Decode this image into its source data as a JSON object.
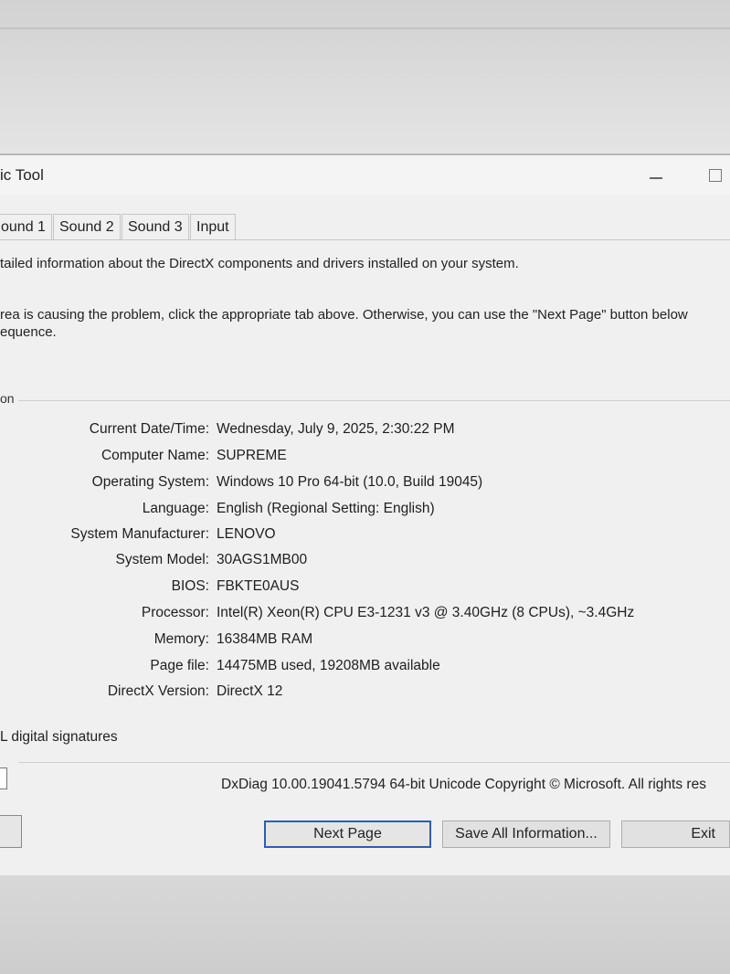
{
  "window": {
    "title": "ic Tool"
  },
  "tabs": [
    {
      "label": "ound 1"
    },
    {
      "label": "Sound 2"
    },
    {
      "label": "Sound 3"
    },
    {
      "label": "Input"
    }
  ],
  "description": {
    "line1": "tailed information about the DirectX components and drivers installed on your system.",
    "line2": "rea is causing the problem, click the appropriate tab above.  Otherwise, you can use the \"Next Page\" button below",
    "line3": "equence."
  },
  "section": {
    "label": "on"
  },
  "system_info": [
    {
      "label": "Current Date/Time:",
      "value": "Wednesday, July 9, 2025, 2:30:22 PM"
    },
    {
      "label": "Computer Name:",
      "value": "SUPREME"
    },
    {
      "label": "Operating System:",
      "value": "Windows 10 Pro 64-bit (10.0, Build 19045)"
    },
    {
      "label": "Language:",
      "value": "English (Regional Setting: English)"
    },
    {
      "label": "System Manufacturer:",
      "value": "LENOVO"
    },
    {
      "label": "System Model:",
      "value": "30AGS1MB00"
    },
    {
      "label": "BIOS:",
      "value": "FBKTE0AUS"
    },
    {
      "label": "Processor:",
      "value": "Intel(R) Xeon(R) CPU E3-1231 v3 @ 3.40GHz (8 CPUs), ~3.4GHz"
    },
    {
      "label": "Memory:",
      "value": "16384MB RAM"
    },
    {
      "label": "Page file:",
      "value": "14475MB used, 19208MB available"
    },
    {
      "label": "DirectX Version:",
      "value": "DirectX 12"
    }
  ],
  "whql": {
    "label": "L digital signatures"
  },
  "footer": {
    "version_text": "DxDiag 10.00.19041.5794 64-bit Unicode  Copyright © Microsoft. All rights res"
  },
  "buttons": {
    "next_page": "Next Page",
    "save_all": "Save All Information...",
    "exit": "Exit"
  },
  "colors": {
    "window_bg": "#f0f0f0",
    "default_button_border": "#2f5fa8"
  }
}
